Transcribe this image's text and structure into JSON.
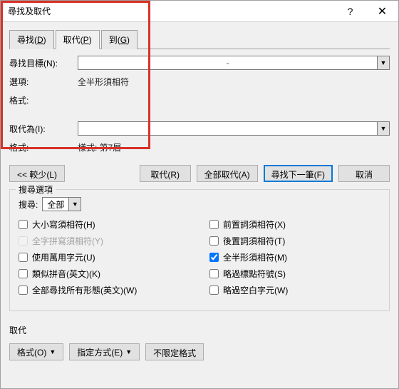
{
  "window": {
    "title": "尋找及取代",
    "help": "?",
    "close": "✕"
  },
  "tabs": {
    "find": "尋找(D)",
    "replace": "取代(P)",
    "goto": "到(G)"
  },
  "find": {
    "label": "尋找目標(N):",
    "value": "-",
    "options_label": "選項:",
    "options_value": "全半形須相符",
    "format_label": "格式:"
  },
  "replace": {
    "label": "取代為(I):",
    "value": "",
    "format_label": "格式:",
    "format_value": "樣式: 第7層"
  },
  "buttons": {
    "less": "<< 較少(L)",
    "replace": "取代(R)",
    "replace_all": "全部取代(A)",
    "find_next": "尋找下一筆(F)",
    "cancel": "取消"
  },
  "search_opts": {
    "title": "搜尋選項",
    "search_label": "搜尋:",
    "search_value": "全部",
    "chk": {
      "match_case": "大小寫須相符(H)",
      "whole_word": "全字拼寫須相符(Y)",
      "wildcards": "使用萬用字元(U)",
      "sounds_like": "類似拼音(英文)(K)",
      "all_forms": "全部尋找所有形態(英文)(W)",
      "prefix": "前置詞須相符(X)",
      "suffix": "後置詞須相符(T)",
      "width": "全半形須相符(M)",
      "punct": "略過標點符號(S)",
      "whitespace": "略過空白字元(W)"
    }
  },
  "replace_sec": {
    "title": "取代",
    "format": "格式(O)",
    "special": "指定方式(E)",
    "no_format": "不限定格式"
  },
  "icons": {
    "chevron_down": "▼"
  }
}
